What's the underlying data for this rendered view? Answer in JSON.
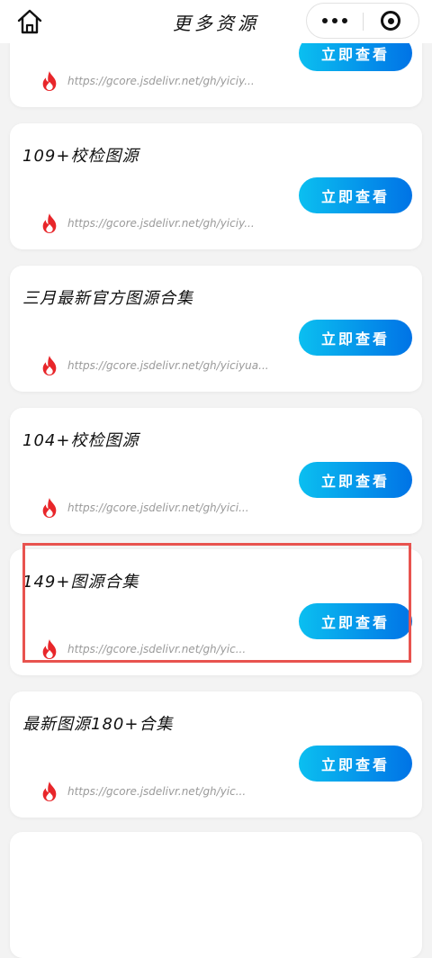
{
  "nav": {
    "title": "更多资源"
  },
  "cards": [
    {
      "title": "",
      "button": "立即查看",
      "url": "https://gcore.jsdelivr.net/gh/yiciy..."
    },
    {
      "title": "109+校检图源",
      "button": "立即查看",
      "url": "https://gcore.jsdelivr.net/gh/yiciy..."
    },
    {
      "title": "三月最新官方图源合集",
      "button": "立即查看",
      "url": "https://gcore.jsdelivr.net/gh/yiciyua..."
    },
    {
      "title": "104+校检图源",
      "button": "立即查看",
      "url": "https://gcore.jsdelivr.net/gh/yici..."
    },
    {
      "title": "149+图源合集",
      "button": "立即查看",
      "url": "https://gcore.jsdelivr.net/gh/yic..."
    },
    {
      "title": "最新图源180+合集",
      "button": "立即查看",
      "url": "https://gcore.jsdelivr.net/gh/yic..."
    }
  ],
  "colors": {
    "button_gradient_start": "#0bbff0",
    "button_gradient_end": "#0073e6",
    "fire_icon": "#e8262a",
    "highlight_border": "#e8534f"
  },
  "icons": {
    "home": "home-icon",
    "more": "more-dots-icon",
    "close": "target-close-icon",
    "fire": "fire-icon"
  }
}
